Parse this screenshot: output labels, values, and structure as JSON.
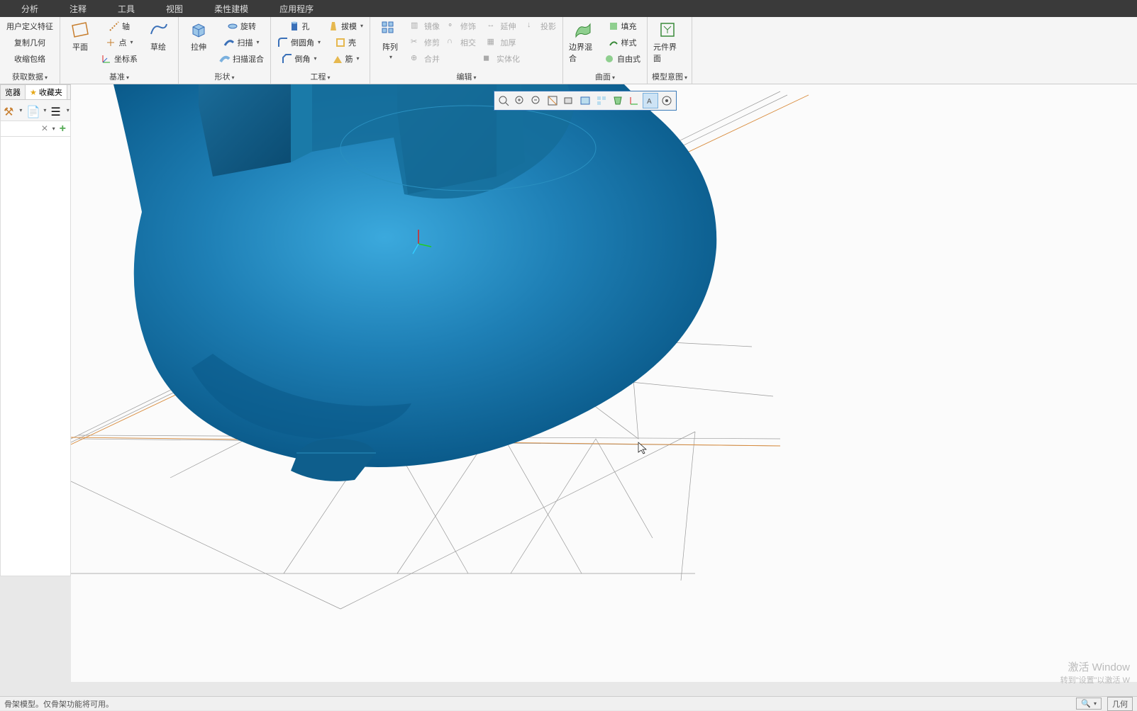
{
  "menu": {
    "items": [
      "分析",
      "注释",
      "工具",
      "视图",
      "柔性建模",
      "应用程序"
    ]
  },
  "ribbon": {
    "group0": {
      "items": [
        "用户定义特征",
        "复制几何",
        "收缩包络"
      ],
      "label": "获取数据"
    },
    "group1": {
      "plane": "平面",
      "axis": "轴",
      "point": "点",
      "csys": "坐标系",
      "sketch": "草绘",
      "label": "基准"
    },
    "group2": {
      "extrude": "拉伸",
      "revolve": "旋转",
      "sweep": "扫描",
      "sweep_blend": "扫描混合",
      "hole": "孔",
      "round": "倒圆角",
      "chamfer": "倒角",
      "draft": "拔模",
      "shell": "壳",
      "rib": "筋",
      "label": "形状",
      "eng_label": "工程"
    },
    "group3": {
      "pattern": "阵列",
      "mirror": "镜像",
      "trim": "修剪",
      "merge": "合并",
      "fix": "修饰",
      "intersect": "相交",
      "extend": "延伸",
      "thicken": "加厚",
      "project": "投影",
      "solidify": "实体化",
      "label": "编辑"
    },
    "group4": {
      "boundary": "边界混合",
      "fill": "填充",
      "style": "样式",
      "freestyle": "自由式",
      "label": "曲面"
    },
    "group5": {
      "component_ui": "元件界面",
      "label": "模型意图"
    }
  },
  "left": {
    "tab_browser": "览器",
    "tab_favorites": "收藏夹",
    "close": "×",
    "add": "+"
  },
  "status": {
    "message": "骨架模型。仅骨架功能将可用。",
    "right": "几何"
  },
  "watermark": {
    "line1": "激活 Window",
    "line2": "转到\"设置\"以激活 W"
  }
}
